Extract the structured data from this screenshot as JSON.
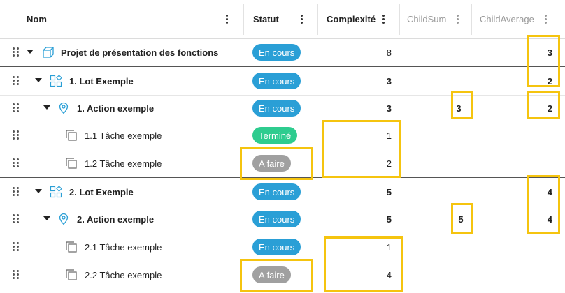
{
  "colors": {
    "en_cours": "#2a9fd6",
    "termine": "#2ecc8f",
    "a_faire": "#a0a0a0",
    "highlight": "#f5c40f",
    "icon_teal": "#2a9fd6"
  },
  "header": {
    "nom": "Nom",
    "statut": "Statut",
    "complexite": "Complexité",
    "childsum": "ChildSum",
    "childaverage": "ChildAverage"
  },
  "rows": [
    {
      "name": "Projet de présentation des fonctions",
      "status": "En cours",
      "complexite": "8",
      "childsum": "",
      "childaverage": "3",
      "icon": "cube-icon"
    },
    {
      "name": "1. Lot Exemple",
      "status": "En cours",
      "complexite": "3",
      "childsum": "",
      "childaverage": "2",
      "icon": "shapes-icon"
    },
    {
      "name": "1. Action exemple",
      "status": "En cours",
      "complexite": "3",
      "childsum": "3",
      "childaverage": "2",
      "icon": "location-pin-icon"
    },
    {
      "name": "1.1 Tâche exemple",
      "status": "Terminé",
      "complexite": "1",
      "childsum": "",
      "childaverage": "",
      "icon": "copy-icon"
    },
    {
      "name": "1.2 Tâche exemple",
      "status": "A faire",
      "complexite": "2",
      "childsum": "",
      "childaverage": "",
      "icon": "copy-icon"
    },
    {
      "name": "2. Lot Exemple",
      "status": "En cours",
      "complexite": "5",
      "childsum": "",
      "childaverage": "4",
      "icon": "shapes-icon"
    },
    {
      "name": "2. Action exemple",
      "status": "En cours",
      "complexite": "5",
      "childsum": "5",
      "childaverage": "4",
      "icon": "location-pin-icon"
    },
    {
      "name": "2.1 Tâche exemple",
      "status": "En cours",
      "complexite": "1",
      "childsum": "",
      "childaverage": "",
      "icon": "copy-icon"
    },
    {
      "name": "2.2 Tâche exemple",
      "status": "A faire",
      "complexite": "4",
      "childsum": "",
      "childaverage": "",
      "icon": "copy-icon"
    }
  ]
}
